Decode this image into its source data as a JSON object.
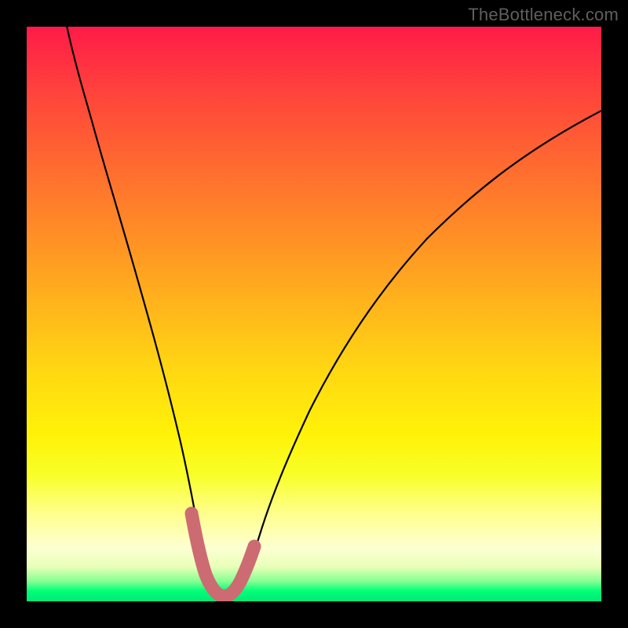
{
  "watermark": "TheBottleneck.com",
  "chart_data": {
    "type": "line",
    "title": "",
    "xlabel": "",
    "ylabel": "",
    "xlim": [
      0,
      100
    ],
    "ylim": [
      0,
      100
    ],
    "grid": false,
    "legend": false,
    "annotations": [],
    "series": [
      {
        "name": "bottleneck-curve",
        "color": "#000000",
        "stroke_width": 2,
        "x": [
          7.0,
          10,
          13,
          16,
          19,
          22,
          25,
          27,
          28.5,
          30,
          31,
          32,
          33,
          34,
          35,
          36,
          37.5,
          39,
          41,
          44,
          48,
          53,
          60,
          68,
          78,
          88,
          100
        ],
        "y": [
          100,
          89,
          78.5,
          68,
          57.5,
          46,
          33.5,
          23.5,
          15.5,
          9,
          5.5,
          3,
          1.5,
          1,
          1.5,
          3,
          6,
          10,
          15.5,
          24,
          33.5,
          43.5,
          54.5,
          64.5,
          73.5,
          80,
          85.5
        ]
      },
      {
        "name": "bottleneck-floor",
        "color": "#cc6b72",
        "stroke_width": 15,
        "stroke_linecap": "round",
        "x": [
          28.5,
          30,
          31,
          32,
          33,
          34,
          35,
          36,
          37.5
        ],
        "y": [
          15.5,
          9,
          5.5,
          3,
          1.5,
          1,
          1.5,
          3,
          6
        ]
      }
    ],
    "background_gradient": {
      "top": "#ff1b48",
      "upper_mid": "#ffb31c",
      "lower_mid": "#fff208",
      "bottom": "#00e978"
    }
  }
}
